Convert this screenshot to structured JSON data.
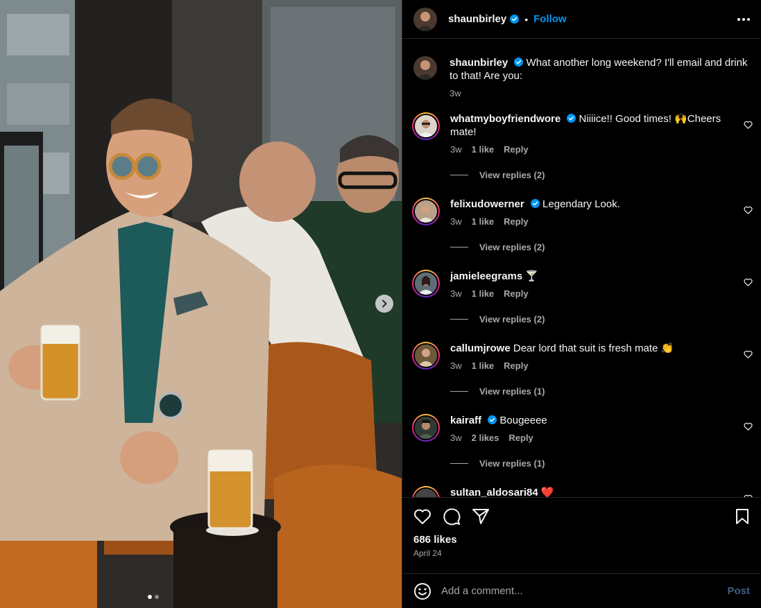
{
  "post": {
    "author": "shaunbirley",
    "separator": "•",
    "follow_label": "Follow",
    "more_icon": "more-horizontal-icon",
    "photo_description": "photo-carousel",
    "carousel": {
      "total": 2,
      "current": 1
    }
  },
  "caption": {
    "author": "shaunbirley",
    "text": "What another long weekend? I'll email and drink to that! Are you:",
    "time": "3w"
  },
  "comments": [
    {
      "user": "whatmyboyfriendwore",
      "verified": true,
      "text": "Niiiice!! Good times! 🙌Cheers mate!",
      "time": "3w",
      "likes": "1 like",
      "reply": "Reply",
      "view_replies": "View replies (2)"
    },
    {
      "user": "felixudowerner",
      "verified": true,
      "text": "Legendary Look.",
      "time": "3w",
      "likes": "1 like",
      "reply": "Reply",
      "view_replies": "View replies (2)"
    },
    {
      "user": "jamieleegrams",
      "verified": false,
      "text": "🍸",
      "time": "3w",
      "likes": "1 like",
      "reply": "Reply",
      "view_replies": "View replies (2)"
    },
    {
      "user": "callumjrowe",
      "verified": false,
      "text": "Dear lord that suit is fresh mate 👏",
      "time": "3w",
      "likes": "1 like",
      "reply": "Reply",
      "view_replies": "View replies (1)"
    },
    {
      "user": "kairaff",
      "verified": true,
      "text": "Bougeeee",
      "time": "3w",
      "likes": "2 likes",
      "reply": "Reply",
      "view_replies": "View replies (1)"
    },
    {
      "user": "sultan_aldosari84",
      "verified": false,
      "text": "❤️",
      "time": "",
      "likes": "",
      "reply": "",
      "view_replies": ""
    }
  ],
  "actions": {
    "likes": "686 likes",
    "date": "April 24"
  },
  "composer": {
    "placeholder": "Add a comment...",
    "post_label": "Post"
  },
  "colors": {
    "background": "#000000",
    "accent": "#0095f6",
    "muted": "#a8a8a8",
    "post_disabled": "#3e5f86"
  }
}
